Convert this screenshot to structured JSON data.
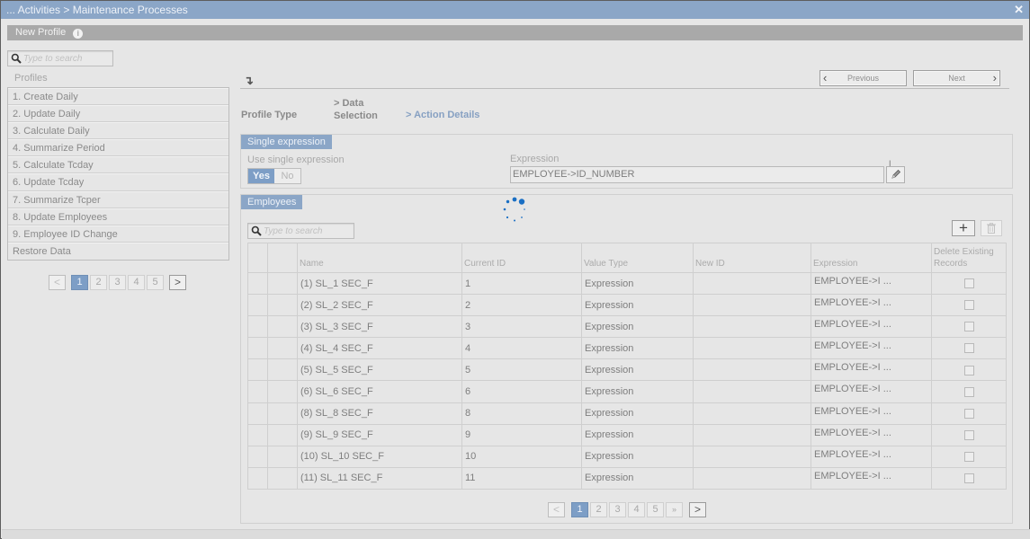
{
  "window": {
    "title": "... Activities > Maintenance Processes",
    "close_icon": "close-icon"
  },
  "toolbar": {
    "title": "New Profile",
    "info_icon": "i"
  },
  "sidebar": {
    "search_placeholder": "Type to search",
    "profiles_label": "Profiles",
    "items": [
      {
        "label": "1. Create Daily"
      },
      {
        "label": "2. Update Daily"
      },
      {
        "label": "3. Calculate Daily"
      },
      {
        "label": "4. Summarize Period"
      },
      {
        "label": "5. Calculate Tcday"
      },
      {
        "label": "6. Update Tcday"
      },
      {
        "label": "7. Summarize Tcper"
      },
      {
        "label": "8. Update Employees"
      },
      {
        "label": "9. Employee ID Change"
      },
      {
        "label": "Restore Data"
      }
    ],
    "pager": {
      "prev": "<",
      "next": ">",
      "pages": [
        "1",
        "2",
        "3",
        "4",
        "5"
      ],
      "current": "1"
    }
  },
  "wizard": {
    "collapse_icon": "↴",
    "previous_label": "Previous",
    "next_label": "Next",
    "steps": [
      {
        "label": "Profile Type",
        "active": false
      },
      {
        "label_line1": "> Data",
        "label_line2": "Selection",
        "active": false
      },
      {
        "label": "> Action Details",
        "active": true
      }
    ]
  },
  "single_expression": {
    "title": "Single expression",
    "use_label": "Use single expression",
    "yes_label": "Yes",
    "no_label": "No",
    "selected": "Yes",
    "expression_label": "Expression",
    "expression_value": "EMPLOYEE->ID_NUMBER",
    "cursor_mark": "I"
  },
  "employees": {
    "title": "Employees",
    "search_placeholder": "Type to search",
    "add_icon": "+",
    "delete_icon": "trash",
    "columns": [
      "",
      "",
      "Name",
      "Current ID",
      "Value Type",
      "New ID",
      "Expression",
      "Delete Existing Records"
    ],
    "rows": [
      {
        "name": "(1) SL_1 SEC_F",
        "current_id": "1",
        "value_type": "Expression",
        "new_id": "",
        "expression": "EMPLOYEE->I ...",
        "delete": false
      },
      {
        "name": "(2) SL_2 SEC_F",
        "current_id": "2",
        "value_type": "Expression",
        "new_id": "",
        "expression": "EMPLOYEE->I ...",
        "delete": false
      },
      {
        "name": "(3) SL_3 SEC_F",
        "current_id": "3",
        "value_type": "Expression",
        "new_id": "",
        "expression": "EMPLOYEE->I ...",
        "delete": false
      },
      {
        "name": "(4) SL_4 SEC_F",
        "current_id": "4",
        "value_type": "Expression",
        "new_id": "",
        "expression": "EMPLOYEE->I ...",
        "delete": false
      },
      {
        "name": "(5) SL_5 SEC_F",
        "current_id": "5",
        "value_type": "Expression",
        "new_id": "",
        "expression": "EMPLOYEE->I ...",
        "delete": false
      },
      {
        "name": "(6) SL_6 SEC_F",
        "current_id": "6",
        "value_type": "Expression",
        "new_id": "",
        "expression": "EMPLOYEE->I ...",
        "delete": false
      },
      {
        "name": "(8) SL_8 SEC_F",
        "current_id": "8",
        "value_type": "Expression",
        "new_id": "",
        "expression": "EMPLOYEE->I ...",
        "delete": false
      },
      {
        "name": "(9) SL_9 SEC_F",
        "current_id": "9",
        "value_type": "Expression",
        "new_id": "",
        "expression": "EMPLOYEE->I ...",
        "delete": false
      },
      {
        "name": "(10) SL_10 SEC_F",
        "current_id": "10",
        "value_type": "Expression",
        "new_id": "",
        "expression": "EMPLOYEE->I ...",
        "delete": false
      },
      {
        "name": "(11) SL_11 SEC_F",
        "current_id": "11",
        "value_type": "Expression",
        "new_id": "",
        "expression": "EMPLOYEE->I ...",
        "delete": false
      }
    ],
    "pager": {
      "prev": "<",
      "next": ">",
      "pages": [
        "1",
        "2",
        "3",
        "4",
        "5"
      ],
      "more": "»",
      "current": "1"
    }
  },
  "colors": {
    "accent": "#8ba6c7",
    "active_page": "#7d9ec6",
    "spinner": "#1a6fc4",
    "toolbar": "#a9a9a9"
  }
}
